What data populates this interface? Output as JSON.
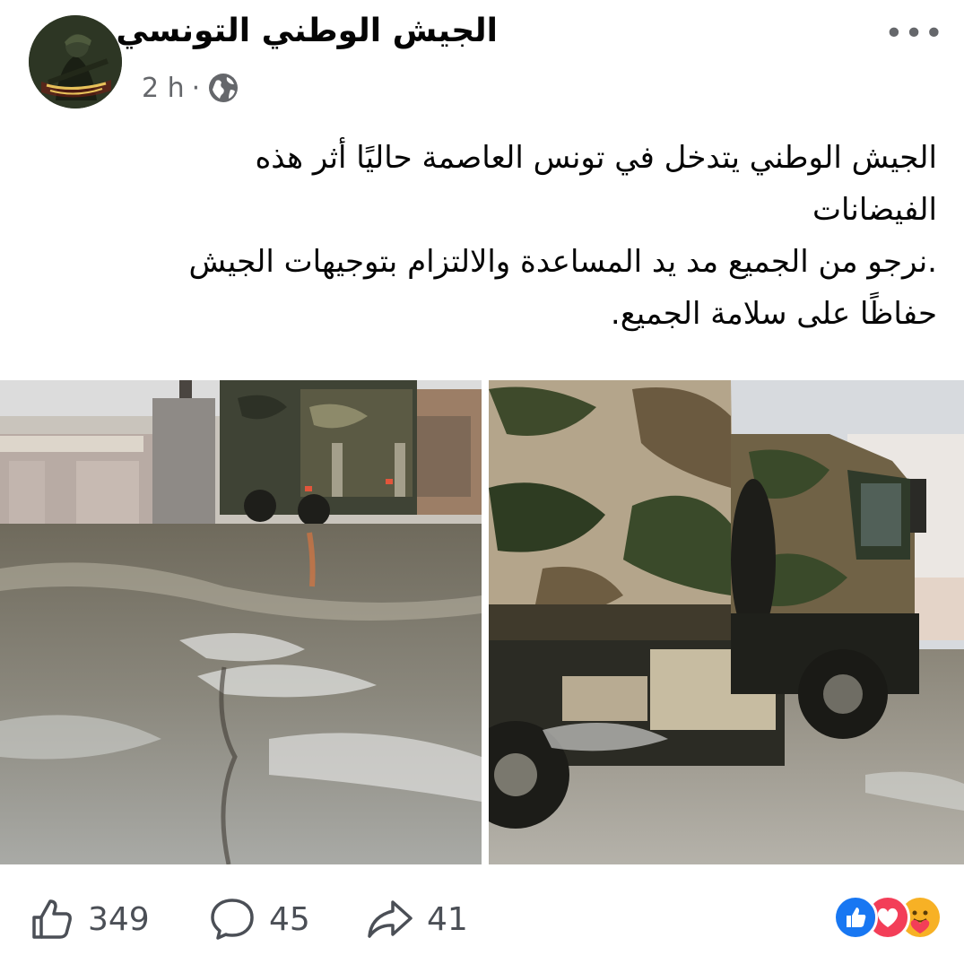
{
  "post": {
    "page_name": "الجيش الوطني التونسي",
    "timestamp": "2 h",
    "separator": "·",
    "privacy_icon": "globe-icon",
    "more_icon": "more-options-icon",
    "text_lines": [
      "الجيش الوطني يتدخل في  تونس العاصمة حاليًا أثر هذه",
      "الفيضانات",
      ".نرجو من الجميع مد يد المساعدة والالتزام بتوجيهات الجيش",
      "حفاظًا على سلامة الجميع."
    ]
  },
  "photos": [
    {
      "description_icon": "photo-flooded-street-truck"
    },
    {
      "description_icon": "photo-army-truck-closeup"
    }
  ],
  "stats": {
    "likes": "349",
    "comments": "45",
    "shares": "41",
    "reaction_icons": [
      "like-reaction-icon",
      "love-reaction-icon",
      "care-reaction-icon"
    ]
  },
  "colors": {
    "text": "#050505",
    "secondary": "#65676b",
    "like_blue": "#1877f2",
    "love_red": "#f33e58",
    "care_yellow": "#f7b125"
  }
}
